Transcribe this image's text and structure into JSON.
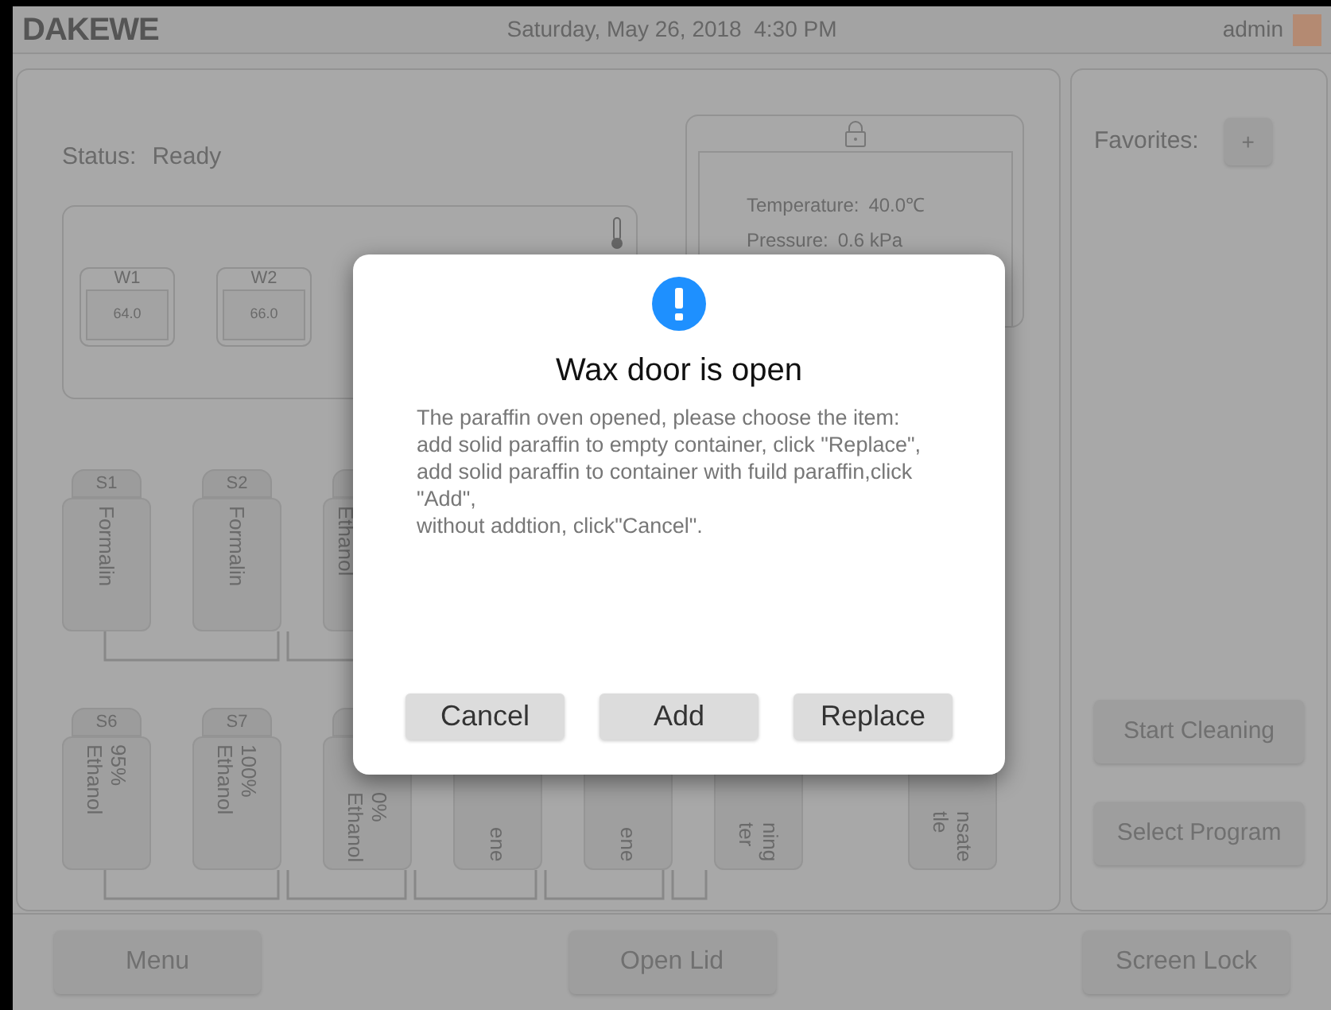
{
  "header": {
    "logo": "DAKEWE",
    "datetime": "Saturday, May 26, 2018  4:30 PM",
    "user": "admin"
  },
  "status": {
    "label": "Status:",
    "value": "Ready"
  },
  "wax_baths": [
    {
      "label": "W1",
      "value": "64.0"
    },
    {
      "label": "W2",
      "value": "66.0"
    }
  ],
  "chamber": {
    "readings": [
      {
        "label": "Temperature:",
        "value": "40.0℃"
      },
      {
        "label": "Pressure:",
        "value": "0.6 kPa"
      }
    ]
  },
  "reagent_rows": [
    [
      {
        "cap": "S1",
        "lines": [
          "Formalin"
        ]
      },
      {
        "cap": "S2",
        "lines": [
          "Formalin"
        ]
      },
      {
        "lines": [
          "Ethanol"
        ]
      }
    ],
    [
      {
        "cap": "S6",
        "lines": [
          "95%",
          "Ethanol"
        ]
      },
      {
        "cap": "S7",
        "lines": [
          "100%",
          "Ethanol"
        ]
      },
      {
        "lines": [
          "0%",
          "Ethanol"
        ]
      },
      {
        "lines": [
          "ene"
        ]
      },
      {
        "lines": [
          "ene"
        ]
      },
      {
        "lines": [
          "ning",
          "ter"
        ]
      },
      {
        "lines": [
          "nsate",
          "tle"
        ]
      }
    ]
  ],
  "favorites": {
    "label": "Favorites:",
    "add": "+"
  },
  "side_buttons": [
    "Start Cleaning",
    "Select Program"
  ],
  "footer_buttons": [
    "Menu",
    "Open Lid",
    "Screen Lock"
  ],
  "dialog": {
    "title": "Wax door is open",
    "message": "The paraffin oven opened, please choose the item:\nadd solid paraffin to empty container, click \"Replace\",\nadd solid paraffin to container with fuild paraffin,click \"Add\",\nwithout addtion, click\"Cancel\".",
    "buttons": [
      "Cancel",
      "Add",
      "Replace"
    ]
  }
}
